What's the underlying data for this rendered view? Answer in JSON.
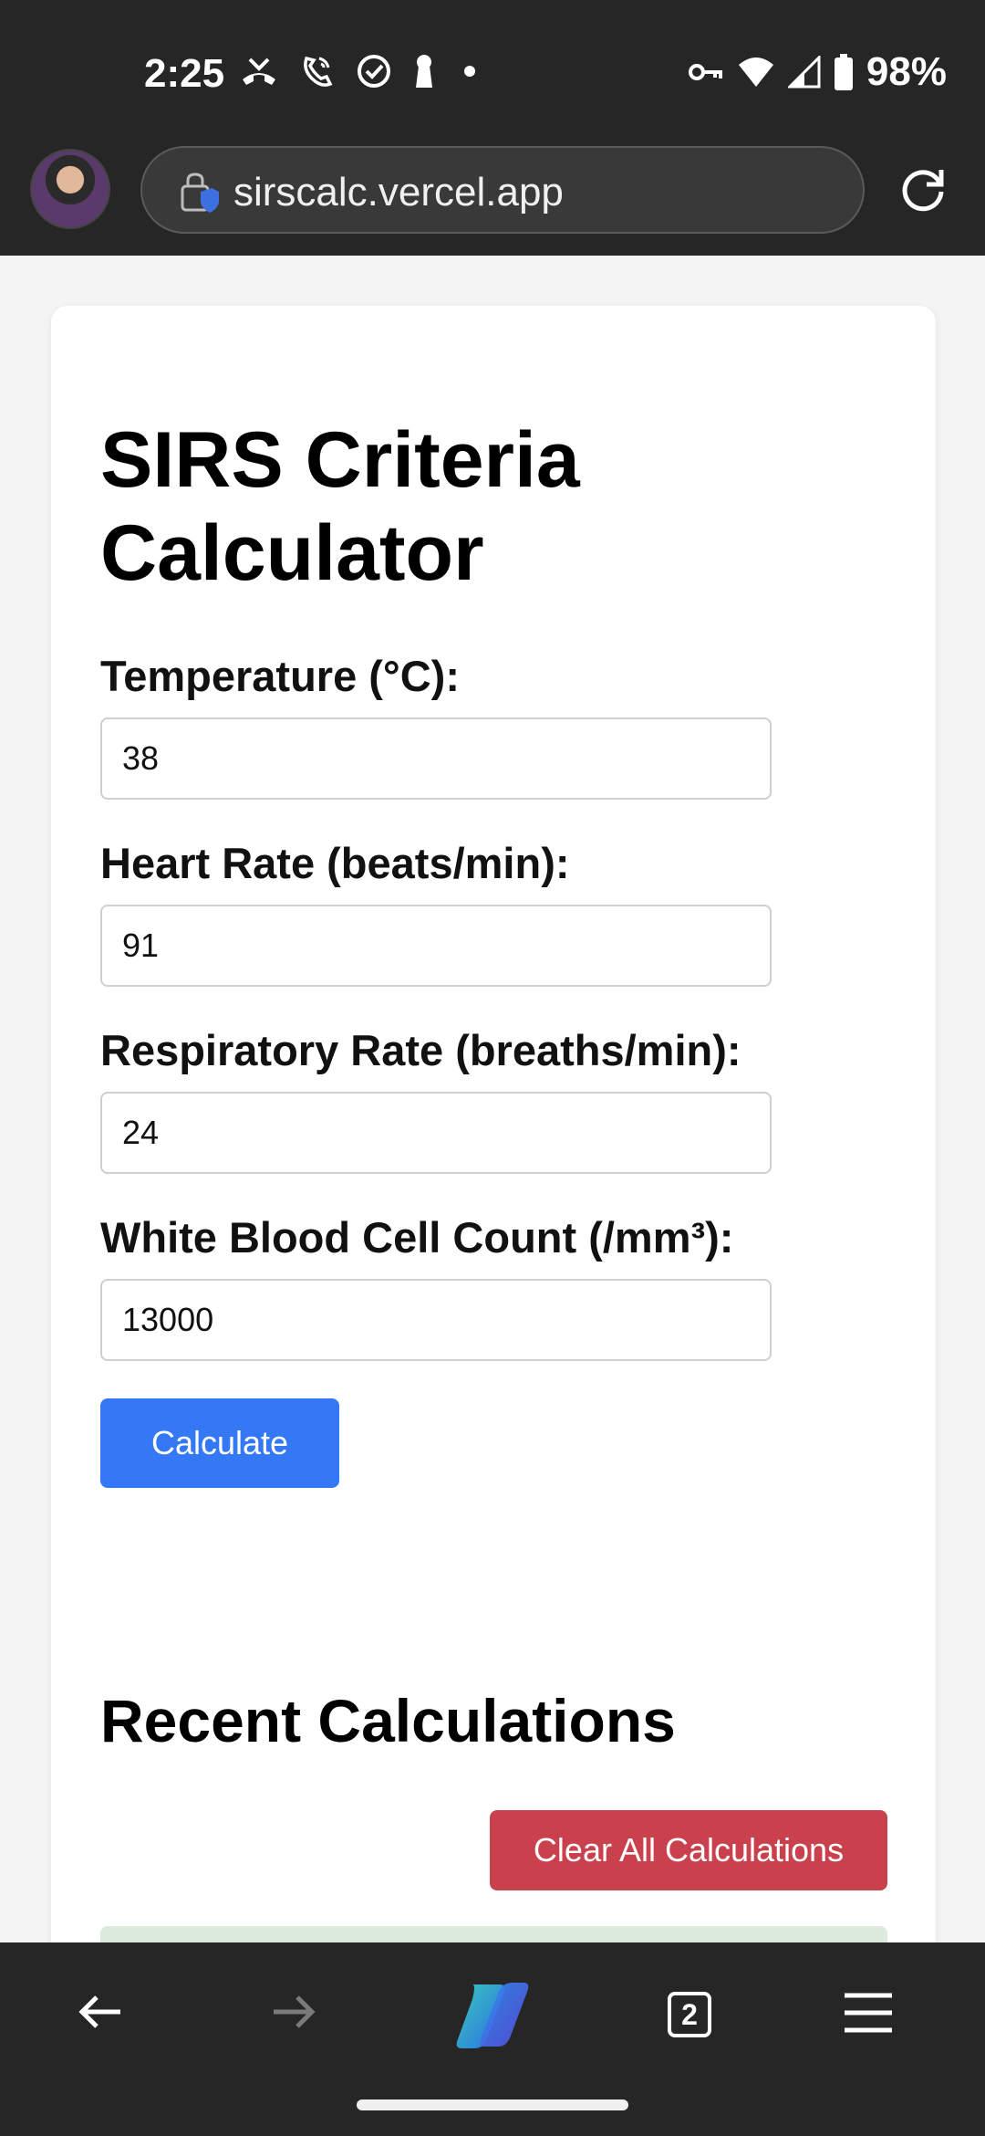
{
  "status_bar": {
    "time": "2:25",
    "battery": "98%"
  },
  "browser": {
    "url": "sirscalc.vercel.app",
    "tab_count": "2"
  },
  "page": {
    "title": "SIRS Criteria Calculator",
    "fields": [
      {
        "label": "Temperature (°C):",
        "value": "38"
      },
      {
        "label": "Heart Rate (beats/min):",
        "value": "91"
      },
      {
        "label": "Respiratory Rate (breaths/min):",
        "value": "24"
      },
      {
        "label": "White Blood Cell Count (/mm³):",
        "value": "13000"
      }
    ],
    "calculate_label": "Calculate",
    "recent_title": "Recent Calculations",
    "clear_label": "Clear All Calculations"
  },
  "colors": {
    "accent": "#3478f6",
    "danger": "#c9414c",
    "chrome": "#262626"
  }
}
